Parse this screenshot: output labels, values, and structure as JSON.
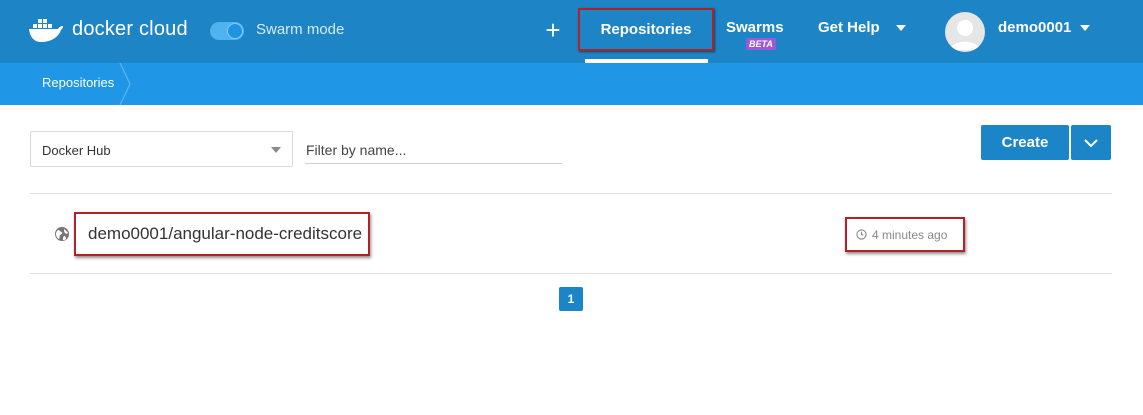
{
  "header": {
    "logo_text": "docker cloud",
    "swarm_mode_label": "Swarm mode",
    "nav": {
      "add_label": "+",
      "repositories": "Repositories",
      "swarms": "Swarms",
      "swarms_badge": "BETA",
      "help": "Get Help",
      "username": "demo0001"
    }
  },
  "breadcrumb": {
    "items": [
      "Repositories"
    ]
  },
  "filters": {
    "source_select_value": "Docker Hub",
    "name_filter_placeholder": "Filter by name...",
    "name_filter_value": ""
  },
  "actions": {
    "create_label": "Create"
  },
  "repositories": [
    {
      "name": "demo0001/angular-node-creditscore",
      "updated": "4 minutes ago",
      "visibility": "public"
    }
  ],
  "pagination": {
    "current_page": "1"
  },
  "colors": {
    "topbar": "#1d84c6",
    "breadcrumb_bar": "#1f97e6",
    "primary_button": "#1b85c7",
    "beta_badge": "#9b59d6",
    "highlight_box": "#b2202a"
  },
  "icons": {
    "logo": "docker-whale-icon",
    "add": "plus-icon",
    "dropdown": "chevron-down-icon",
    "visibility": "globe-icon",
    "time": "clock-icon",
    "avatar": "user-avatar-icon"
  }
}
